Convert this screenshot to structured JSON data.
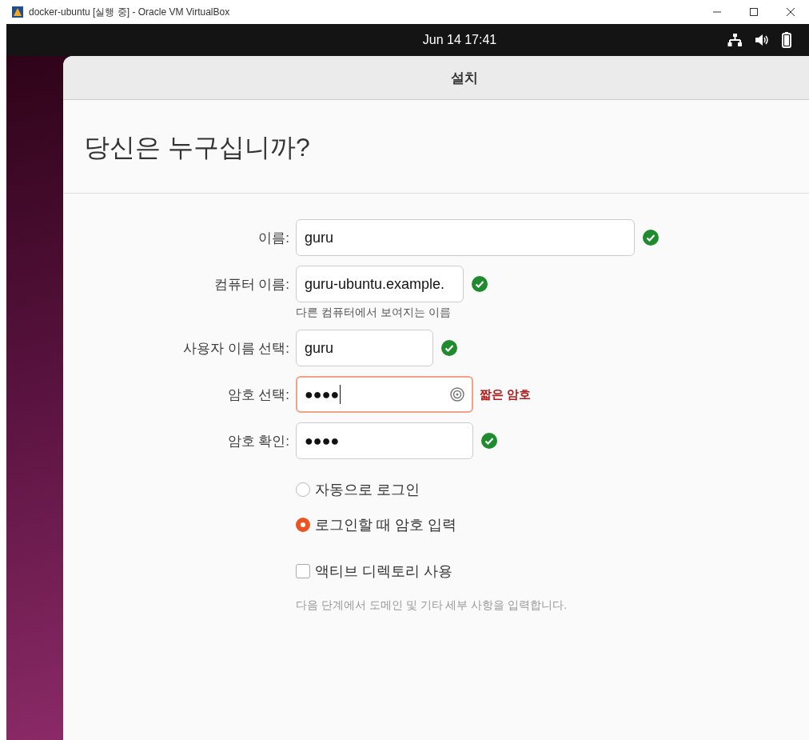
{
  "window": {
    "title": "docker-ubuntu [실행 중] - Oracle VM VirtualBox"
  },
  "top_bar": {
    "clock": "Jun 14  17:41"
  },
  "installer": {
    "title": "설치",
    "heading": "당신은 누구십니까?",
    "fields": [
      {
        "label": "이름:",
        "kind": "text",
        "value": "guru",
        "valid": true,
        "error": false
      },
      {
        "label": "컴퓨터 이름:",
        "kind": "text",
        "value": "guru-ubuntu.example.",
        "valid": true,
        "error": false,
        "hint": "다른 컴퓨터에서 보여지는 이름"
      },
      {
        "label": "사용자 이름 선택:",
        "kind": "text",
        "value": "guru",
        "valid": true,
        "error": false
      },
      {
        "label": "암호 선택:",
        "kind": "password",
        "value": "●●●●",
        "valid": false,
        "error": true,
        "message": "짧은 암호"
      },
      {
        "label": "암호 확인:",
        "kind": "text",
        "value": "●●●●",
        "valid": true,
        "error": false
      }
    ],
    "login_options": [
      {
        "label": "자동으로 로그인",
        "selected": false
      },
      {
        "label": "로그인할 때 암호 입력",
        "selected": true
      }
    ],
    "active_directory": {
      "label": "액티브 디렉토리 사용",
      "checked": false
    },
    "note": "다음 단계에서 도메인 및 기타 세부 사항을 입력합니다."
  }
}
